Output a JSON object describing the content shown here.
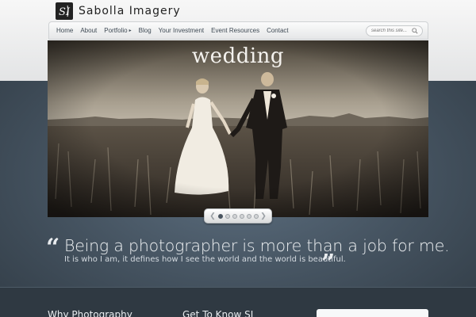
{
  "brand": {
    "logo_mark": "SI",
    "name": "Sabolla Imagery"
  },
  "nav": {
    "items": [
      {
        "label": "Home"
      },
      {
        "label": "About"
      },
      {
        "label": "Portfolio",
        "has_submenu": true
      },
      {
        "label": "Blog"
      },
      {
        "label": "Your Investment"
      },
      {
        "label": "Event Resources"
      },
      {
        "label": "Contact"
      }
    ],
    "search_placeholder": "search this site..."
  },
  "slider": {
    "title": "wedding",
    "slide_count": 6,
    "active_slide": 1
  },
  "quote": {
    "main": "Being a photographer is more than a job for me.",
    "sub": "It is who I am, it defines how I see the world and the world is beautiful."
  },
  "footer": {
    "col1_heading": "Why Photography",
    "col2_heading": "Get To Know SI"
  },
  "colors": {
    "accent": "#3f4a55",
    "quote_text": "#eef1f3"
  }
}
